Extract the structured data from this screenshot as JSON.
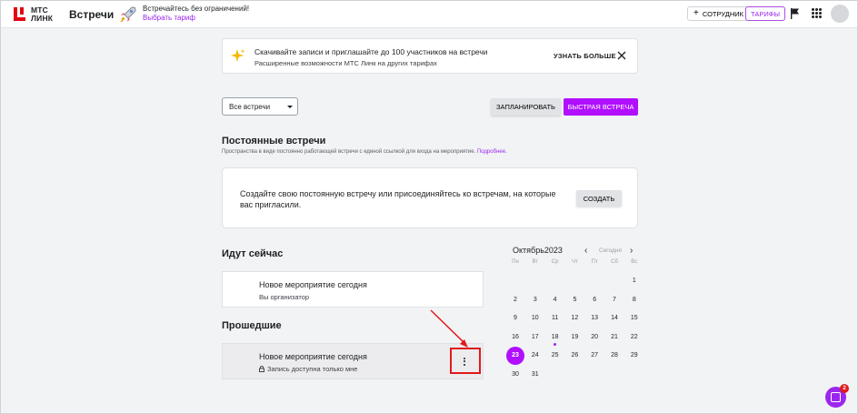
{
  "header": {
    "logo_line1": "МТС",
    "logo_line2": "ЛИНК",
    "app_title": "Встречи",
    "promo_text": "Встречайтесь без ограничений!",
    "promo_link": "Выбрать тариф",
    "employee_button": "СОТРУДНИК",
    "tariffs_button": "ТАРИФЫ",
    "icons": [
      "plus-icon",
      "flag-icon",
      "apps-grid-icon",
      "avatar"
    ]
  },
  "banner": {
    "title": "Скачивайте записи и приглашайте до 100 участников на встречи",
    "subtitle": "Расширенные возможности МТС Линк на других тарифах",
    "learn_more": "УЗНАТЬ БОЛЬШЕ",
    "icons": [
      "sparkle-icon",
      "close-icon"
    ]
  },
  "controls": {
    "filter_value": "Все встречи",
    "schedule_button": "ЗАПЛАНИРОВАТЬ",
    "quick_meeting_button": "БЫСТРАЯ ВСТРЕЧА"
  },
  "permanent": {
    "heading": "Постоянные встречи",
    "description": "Пространства в виде постоянно работающей встречи с единой ссылкой для входа на мероприятие.",
    "description_link": "Подробнее.",
    "card_text": "Создайте свою постоянную встречу или присоединяйтесь ко встречам, на которые вас пригласили.",
    "create_button": "СОЗДАТЬ"
  },
  "now": {
    "heading": "Идут сейчас",
    "event_title": "Новое мероприятие сегодня",
    "event_sub": "Вы организатор"
  },
  "past": {
    "heading": "Прошедшие",
    "event_title": "Новое мероприятие сегодня",
    "event_sub": "Запись доступна только мне"
  },
  "calendar": {
    "month_year": "Октябрь2023",
    "today_label": "Сегодня",
    "weekdays": [
      "Пн",
      "Вт",
      "Ср",
      "Чт",
      "Пт",
      "Сб",
      "Вс"
    ],
    "first_weekday_index": 6,
    "days_in_month": 31,
    "selected_day": 23,
    "event_days": [
      18
    ]
  },
  "chat": {
    "badge": "2"
  },
  "colors": {
    "accent": "#9b27ee",
    "primary_button": "#b010ff",
    "highlight": "#e0191c",
    "logo_red": "#e30611"
  }
}
